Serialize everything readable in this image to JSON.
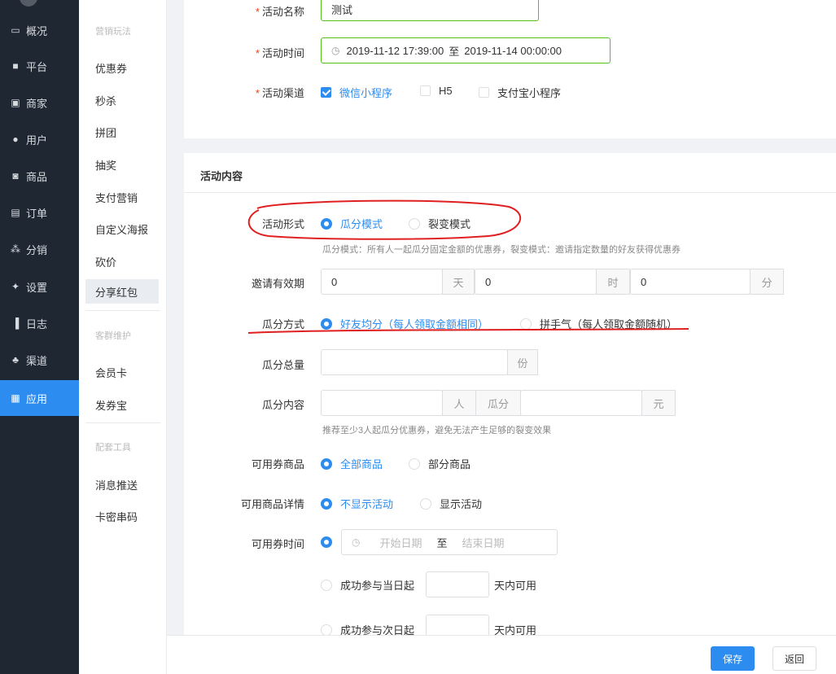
{
  "nav": {
    "items": [
      {
        "icon": "monitor-icon",
        "label": "概况"
      },
      {
        "icon": "desktop-icon",
        "label": "平台"
      },
      {
        "icon": "store-icon",
        "label": "商家"
      },
      {
        "icon": "user-icon",
        "label": "用户"
      },
      {
        "icon": "product-icon",
        "label": "商品"
      },
      {
        "icon": "order-icon",
        "label": "订单"
      },
      {
        "icon": "share-icon",
        "label": "分销"
      },
      {
        "icon": "gear-icon",
        "label": "设置"
      },
      {
        "icon": "log-icon",
        "label": "日志"
      },
      {
        "icon": "channel-icon",
        "label": "渠道"
      },
      {
        "icon": "apps-icon",
        "label": "应用"
      }
    ]
  },
  "submenu": {
    "group1": "营销玩法",
    "items1": [
      "优惠券",
      "秒杀",
      "拼团",
      "抽奖",
      "支付营销",
      "自定义海报",
      "砍价",
      "分享红包"
    ],
    "group2": "客群维护",
    "items2": [
      "会员卡",
      "发券宝"
    ],
    "group3": "配套工具",
    "items3": [
      "消息推送",
      "卡密串码"
    ]
  },
  "basic": {
    "name_label": "活动名称",
    "name_value": "测试",
    "time_label": "活动时间",
    "time_start": "2019-11-12 17:39:00",
    "time_sep": "至",
    "time_end": "2019-11-14 00:00:00",
    "channel_label": "活动渠道",
    "channels": [
      "微信小程序",
      "H5",
      "支付宝小程序"
    ]
  },
  "content": {
    "title": "活动内容",
    "form_label": "活动形式",
    "form_opt1": "瓜分模式",
    "form_opt2": "裂变模式",
    "form_hint": "瓜分模式：所有人一起瓜分固定金额的优惠券，裂变模式：邀请指定数量的好友获得优惠券",
    "valid_label": "邀请有效期",
    "valid_day_value": "0",
    "valid_day_unit": "天",
    "valid_hour_value": "0",
    "valid_hour_unit": "时",
    "valid_min_value": "0",
    "valid_min_unit": "分",
    "split_label": "瓜分方式",
    "split_opt1": "好友均分（每人领取金额相同）",
    "split_opt2": "拼手气（每人领取金额随机）",
    "total_label": "瓜分总量",
    "total_unit": "份",
    "share_label": "瓜分内容",
    "share_unit_people": "人",
    "share_mid": "瓜分",
    "share_unit_yuan": "元",
    "share_hint": "推荐至少3人起瓜分优惠券，避免无法产生足够的裂变效果",
    "goods_label": "可用券商品",
    "goods_opt1": "全部商品",
    "goods_opt2": "部分商品",
    "detail_label": "可用商品详情",
    "detail_opt1": "不显示活动",
    "detail_opt2": "显示活动",
    "time_label": "可用券时间",
    "date_start_placeholder": "开始日期",
    "date_sep": "至",
    "date_end_placeholder": "结束日期",
    "opt_same_day": "成功参与当日起",
    "opt_next_day": "成功参与次日起",
    "days_unit": "天内可用"
  },
  "footer": {
    "save": "保存",
    "back": "返回"
  }
}
